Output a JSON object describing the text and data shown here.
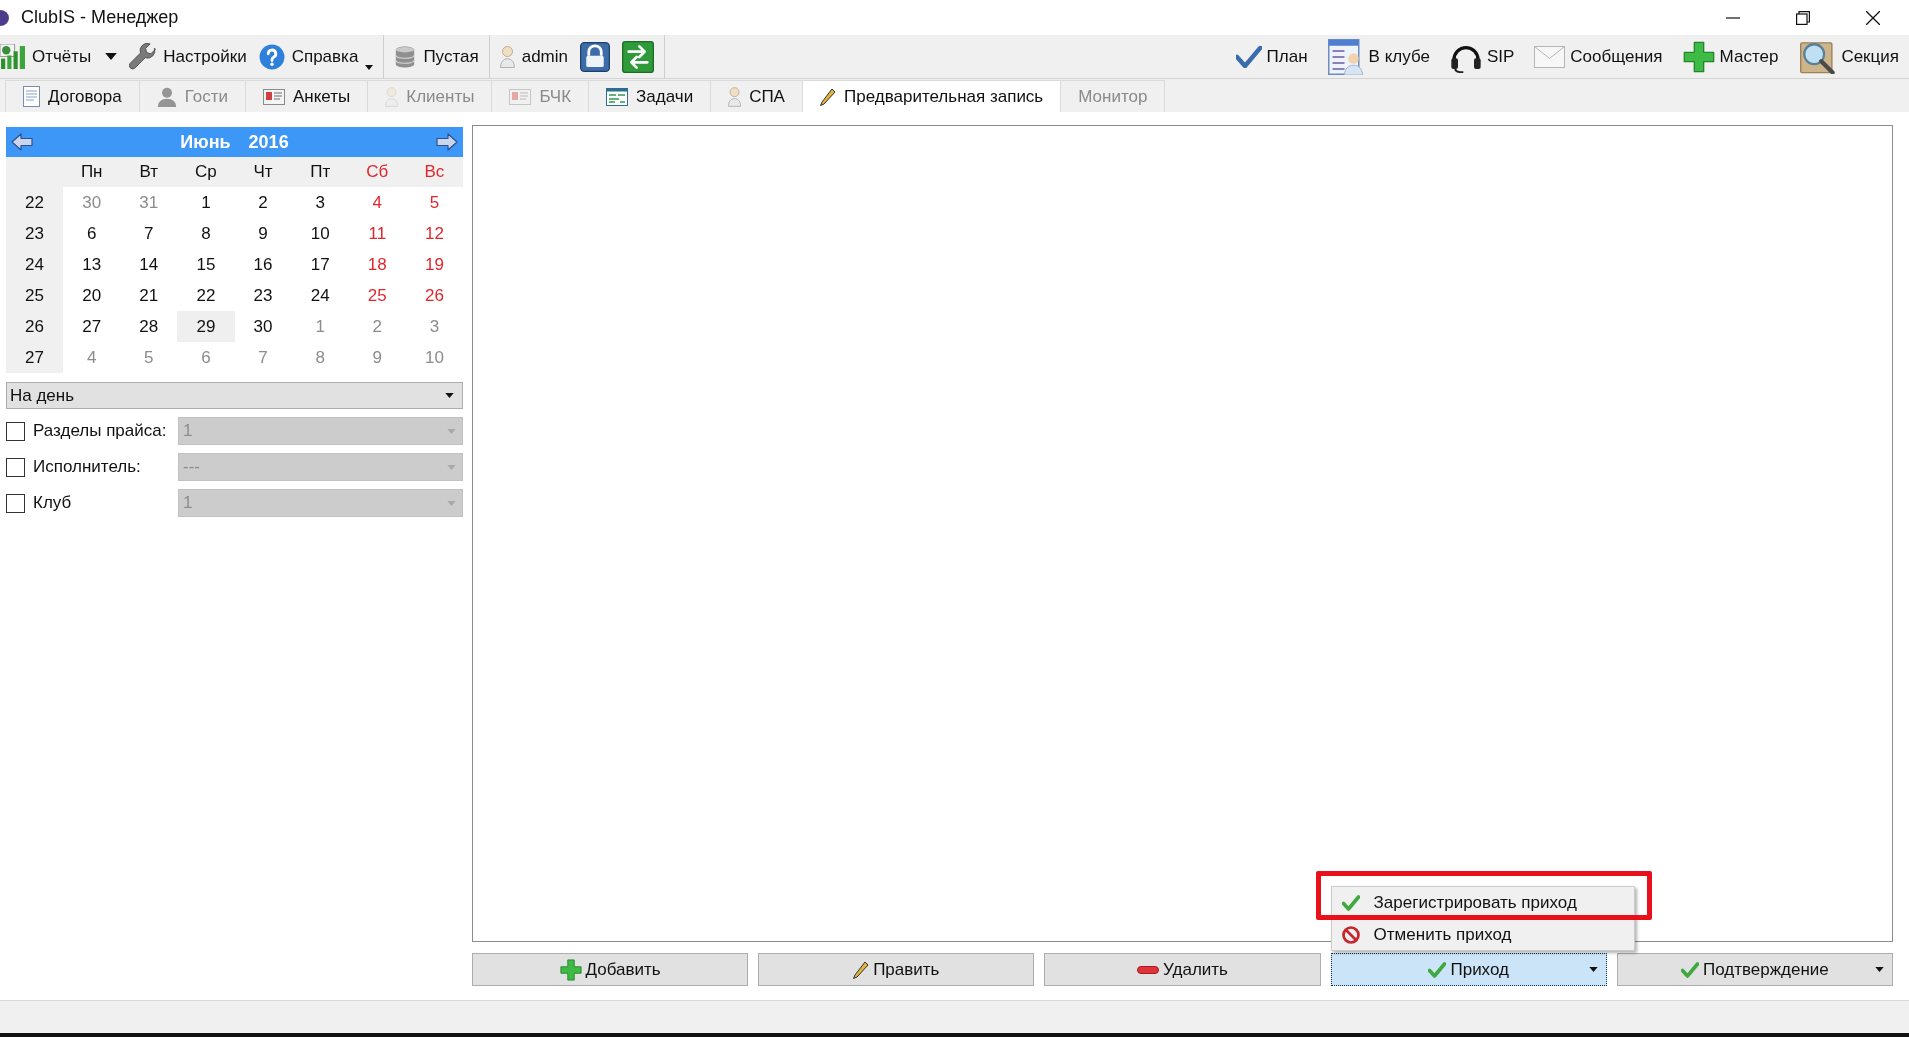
{
  "window": {
    "title": "ClubIS - Менеджер"
  },
  "toolbar": {
    "left_groups": [
      [
        {
          "label": "Отчёты",
          "kind": "split"
        },
        {
          "label": "Настройки",
          "kind": "plain"
        },
        {
          "label": "Справка",
          "kind": "menu"
        }
      ],
      [
        {
          "label": "Пустая",
          "kind": "plain"
        }
      ],
      [
        {
          "label": "admin",
          "kind": "plain"
        },
        {
          "kind": "icon"
        },
        {
          "kind": "icon"
        }
      ]
    ],
    "right": [
      {
        "label": "План"
      },
      {
        "label": "В клубе"
      },
      {
        "label": "SIP"
      },
      {
        "label": "Сообщения"
      },
      {
        "label": "Мастер"
      },
      {
        "label": "Секция"
      }
    ]
  },
  "tabs": [
    {
      "label": "Договора",
      "selected": false,
      "disabled": false
    },
    {
      "label": "Гости",
      "selected": false,
      "disabled": true
    },
    {
      "label": "Анкеты",
      "selected": false,
      "disabled": false
    },
    {
      "label": "Клиенты",
      "selected": false,
      "disabled": true
    },
    {
      "label": "БЧК",
      "selected": false,
      "disabled": true
    },
    {
      "label": "Задачи",
      "selected": false,
      "disabled": false
    },
    {
      "label": "СПА",
      "selected": false,
      "disabled": false
    },
    {
      "label": "Предварительная запись",
      "selected": true,
      "disabled": false
    },
    {
      "label": "Монитор",
      "selected": false,
      "disabled": true
    }
  ],
  "calendar": {
    "month": "Июнь",
    "year": "2016",
    "weekdays": [
      {
        "label": "Пн",
        "weekend": false
      },
      {
        "label": "Вт",
        "weekend": false
      },
      {
        "label": "Ср",
        "weekend": false
      },
      {
        "label": "Чт",
        "weekend": false
      },
      {
        "label": "Пт",
        "weekend": false
      },
      {
        "label": "Сб",
        "weekend": true
      },
      {
        "label": "Вс",
        "weekend": true
      }
    ],
    "weeks": [
      {
        "number": "22",
        "days": [
          {
            "label": "30",
            "kind": "outside",
            "selected": false
          },
          {
            "label": "31",
            "kind": "outside",
            "selected": false
          },
          {
            "label": "1",
            "kind": "weekday",
            "selected": false
          },
          {
            "label": "2",
            "kind": "weekday",
            "selected": false
          },
          {
            "label": "3",
            "kind": "weekday",
            "selected": false
          },
          {
            "label": "4",
            "kind": "weekend",
            "selected": false
          },
          {
            "label": "5",
            "kind": "weekend",
            "selected": false
          }
        ]
      },
      {
        "number": "23",
        "days": [
          {
            "label": "6",
            "kind": "weekday",
            "selected": false
          },
          {
            "label": "7",
            "kind": "weekday",
            "selected": false
          },
          {
            "label": "8",
            "kind": "weekday",
            "selected": false
          },
          {
            "label": "9",
            "kind": "weekday",
            "selected": false
          },
          {
            "label": "10",
            "kind": "weekday",
            "selected": false
          },
          {
            "label": "11",
            "kind": "weekend",
            "selected": false
          },
          {
            "label": "12",
            "kind": "weekend",
            "selected": false
          }
        ]
      },
      {
        "number": "24",
        "days": [
          {
            "label": "13",
            "kind": "weekday",
            "selected": false
          },
          {
            "label": "14",
            "kind": "weekday",
            "selected": false
          },
          {
            "label": "15",
            "kind": "weekday",
            "selected": false
          },
          {
            "label": "16",
            "kind": "weekday",
            "selected": false
          },
          {
            "label": "17",
            "kind": "weekday",
            "selected": false
          },
          {
            "label": "18",
            "kind": "weekend",
            "selected": false
          },
          {
            "label": "19",
            "kind": "weekend",
            "selected": false
          }
        ]
      },
      {
        "number": "25",
        "days": [
          {
            "label": "20",
            "kind": "weekday",
            "selected": false
          },
          {
            "label": "21",
            "kind": "weekday",
            "selected": false
          },
          {
            "label": "22",
            "kind": "weekday",
            "selected": false
          },
          {
            "label": "23",
            "kind": "weekday",
            "selected": false
          },
          {
            "label": "24",
            "kind": "weekday",
            "selected": false
          },
          {
            "label": "25",
            "kind": "weekend",
            "selected": false
          },
          {
            "label": "26",
            "kind": "weekend",
            "selected": false
          }
        ]
      },
      {
        "number": "26",
        "days": [
          {
            "label": "27",
            "kind": "weekday",
            "selected": false
          },
          {
            "label": "28",
            "kind": "weekday",
            "selected": false
          },
          {
            "label": "29",
            "kind": "weekday",
            "selected": true
          },
          {
            "label": "30",
            "kind": "weekday",
            "selected": false
          },
          {
            "label": "1",
            "kind": "outside",
            "selected": false
          },
          {
            "label": "2",
            "kind": "outside",
            "selected": false
          },
          {
            "label": "3",
            "kind": "outside",
            "selected": false
          }
        ]
      },
      {
        "number": "27",
        "days": [
          {
            "label": "4",
            "kind": "outside",
            "selected": false
          },
          {
            "label": "5",
            "kind": "outside",
            "selected": false
          },
          {
            "label": "6",
            "kind": "outside",
            "selected": false
          },
          {
            "label": "7",
            "kind": "outside",
            "selected": false
          },
          {
            "label": "8",
            "kind": "outside",
            "selected": false
          },
          {
            "label": "9",
            "kind": "outside",
            "selected": false
          },
          {
            "label": "10",
            "kind": "outside",
            "selected": false
          }
        ]
      }
    ]
  },
  "period_select": {
    "value": "На день"
  },
  "filters": [
    {
      "label": "Разделы прайса:",
      "checked": false,
      "value": "1",
      "disabled": true
    },
    {
      "label": "Исполнитель:",
      "checked": false,
      "value": "---",
      "disabled": true
    },
    {
      "label": "Клуб",
      "checked": false,
      "value": "1",
      "disabled": true
    }
  ],
  "actions": [
    {
      "label": "Добавить",
      "kind": "add",
      "dropdown": false,
      "expanded": false
    },
    {
      "label": "Править",
      "kind": "edit",
      "dropdown": false,
      "expanded": false
    },
    {
      "label": "Удалить",
      "kind": "delete",
      "dropdown": false,
      "expanded": false
    },
    {
      "label": "Приход",
      "kind": "confirm",
      "dropdown": true,
      "expanded": true,
      "menu": {
        "items": [
          {
            "label": "Зарегистрировать приход",
            "kind": "confirm",
            "framed": true
          },
          {
            "label": "Отменить приход",
            "kind": "cancel",
            "framed": false
          }
        ]
      }
    },
    {
      "label": "Подтверждение",
      "kind": "confirm",
      "dropdown": true,
      "expanded": false
    }
  ]
}
